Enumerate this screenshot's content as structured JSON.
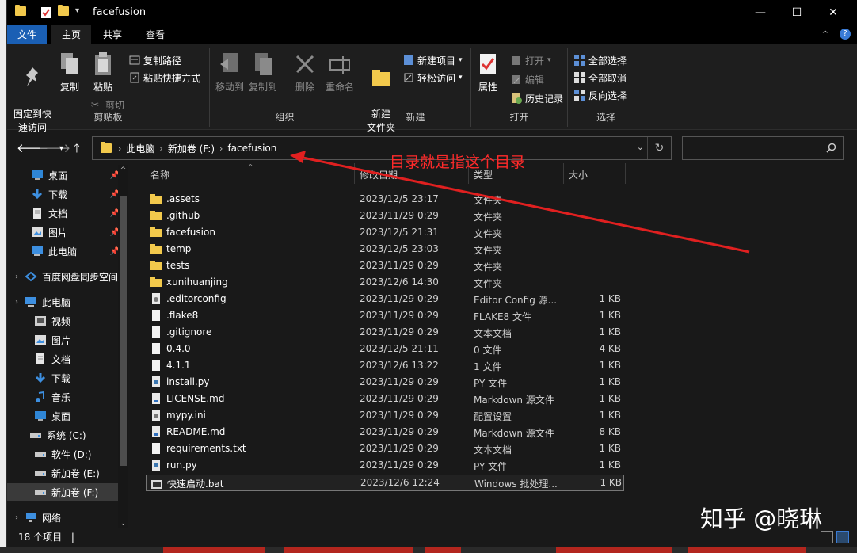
{
  "window": {
    "title": "facefusion",
    "controls": {
      "minimize": "—",
      "maximize": "☐",
      "close": "✕"
    }
  },
  "ribbon_tabs": [
    {
      "label": "文件"
    },
    {
      "label": "主页"
    },
    {
      "label": "共享"
    },
    {
      "label": "查看"
    }
  ],
  "ribbon": {
    "clipboard": {
      "label": "剪贴板",
      "pin": "固定到快\n速访问",
      "copy": "复制",
      "paste": "粘贴",
      "copy_path": "复制路径",
      "paste_shortcut": "粘贴快捷方式",
      "cut": "剪切"
    },
    "organize": {
      "label": "组织",
      "move_to": "移动到",
      "copy_to": "复制到",
      "delete": "删除",
      "rename": "重命名"
    },
    "new": {
      "label": "新建",
      "new_folder": "新建\n文件夹",
      "new_item": "新建项目",
      "easy_access": "轻松访问"
    },
    "open": {
      "label": "打开",
      "properties": "属性",
      "open": "打开",
      "edit": "编辑",
      "history": "历史记录"
    },
    "select": {
      "label": "选择",
      "select_all": "全部选择",
      "select_none": "全部取消",
      "invert": "反向选择"
    }
  },
  "address": {
    "crumbs": [
      "此电脑",
      "新加卷 (F:)",
      "facefusion"
    ],
    "search_placeholder": ""
  },
  "annotation": "目录就是指这个目录",
  "sidebar": [
    {
      "label": "桌面",
      "icon": "desktop-icon",
      "pinned": true
    },
    {
      "label": "下载",
      "icon": "download-icon",
      "pinned": true
    },
    {
      "label": "文档",
      "icon": "document-icon",
      "pinned": true
    },
    {
      "label": "图片",
      "icon": "picture-icon",
      "pinned": true
    },
    {
      "label": "此电脑",
      "icon": "computer-icon",
      "pinned": true
    },
    {
      "label": "百度网盘同步空间",
      "icon": "baidu-icon",
      "pinned": false
    },
    {
      "label": "此电脑",
      "icon": "computer-icon",
      "pinned": false
    },
    {
      "label": "视频",
      "icon": "video-icon",
      "pinned": false
    },
    {
      "label": "图片",
      "icon": "picture-icon",
      "pinned": false
    },
    {
      "label": "文档",
      "icon": "document-icon",
      "pinned": false
    },
    {
      "label": "下载",
      "icon": "download-icon",
      "pinned": false
    },
    {
      "label": "音乐",
      "icon": "music-icon",
      "pinned": false
    },
    {
      "label": "桌面",
      "icon": "desktop-icon",
      "pinned": false
    },
    {
      "label": "系统 (C:)",
      "icon": "drive-icon",
      "pinned": false
    },
    {
      "label": "软件 (D:)",
      "icon": "drive-icon",
      "pinned": false
    },
    {
      "label": "新加卷 (E:)",
      "icon": "drive-icon",
      "pinned": false
    },
    {
      "label": "新加卷 (F:)",
      "icon": "drive-icon",
      "pinned": false
    },
    {
      "label": "网络",
      "icon": "network-icon",
      "pinned": false
    }
  ],
  "columns": {
    "name": "名称",
    "date": "修改日期",
    "type": "类型",
    "size": "大小"
  },
  "files": [
    {
      "name": ".assets",
      "date": "2023/12/5 23:17",
      "type": "文件夹",
      "size": "",
      "kind": "folder"
    },
    {
      "name": ".github",
      "date": "2023/11/29 0:29",
      "type": "文件夹",
      "size": "",
      "kind": "folder"
    },
    {
      "name": "facefusion",
      "date": "2023/12/5 21:31",
      "type": "文件夹",
      "size": "",
      "kind": "folder"
    },
    {
      "name": "temp",
      "date": "2023/12/5 23:03",
      "type": "文件夹",
      "size": "",
      "kind": "folder"
    },
    {
      "name": "tests",
      "date": "2023/11/29 0:29",
      "type": "文件夹",
      "size": "",
      "kind": "folder"
    },
    {
      "name": "xunihuanjing",
      "date": "2023/12/6 14:30",
      "type": "文件夹",
      "size": "",
      "kind": "folder"
    },
    {
      "name": ".editorconfig",
      "date": "2023/11/29 0:29",
      "type": "Editor Config 源...",
      "size": "1 KB",
      "kind": "config"
    },
    {
      "name": ".flake8",
      "date": "2023/11/29 0:29",
      "type": "FLAKE8 文件",
      "size": "1 KB",
      "kind": "file"
    },
    {
      "name": ".gitignore",
      "date": "2023/11/29 0:29",
      "type": "文本文档",
      "size": "1 KB",
      "kind": "text"
    },
    {
      "name": "0.4.0",
      "date": "2023/12/5 21:11",
      "type": "0 文件",
      "size": "4 KB",
      "kind": "file"
    },
    {
      "name": "4.1.1",
      "date": "2023/12/6 13:22",
      "type": "1 文件",
      "size": "1 KB",
      "kind": "file"
    },
    {
      "name": "install.py",
      "date": "2023/11/29 0:29",
      "type": "PY 文件",
      "size": "1 KB",
      "kind": "py"
    },
    {
      "name": "LICENSE.md",
      "date": "2023/11/29 0:29",
      "type": "Markdown 源文件",
      "size": "1 KB",
      "kind": "md"
    },
    {
      "name": "mypy.ini",
      "date": "2023/11/29 0:29",
      "type": "配置设置",
      "size": "1 KB",
      "kind": "ini"
    },
    {
      "name": "README.md",
      "date": "2023/11/29 0:29",
      "type": "Markdown 源文件",
      "size": "8 KB",
      "kind": "md"
    },
    {
      "name": "requirements.txt",
      "date": "2023/11/29 0:29",
      "type": "文本文档",
      "size": "1 KB",
      "kind": "text"
    },
    {
      "name": "run.py",
      "date": "2023/11/29 0:29",
      "type": "PY 文件",
      "size": "1 KB",
      "kind": "py"
    },
    {
      "name": "快速启动.bat",
      "date": "2023/12/6 12:24",
      "type": "Windows 批处理...",
      "size": "1 KB",
      "kind": "bat"
    }
  ],
  "status": {
    "count": "18 个项目",
    "sep": "|"
  },
  "watermark": "知乎 @晓琳",
  "colors": {
    "accent": "#1a5fb4",
    "folder": "#f2c94c",
    "annotation": "#ff2a2a"
  }
}
